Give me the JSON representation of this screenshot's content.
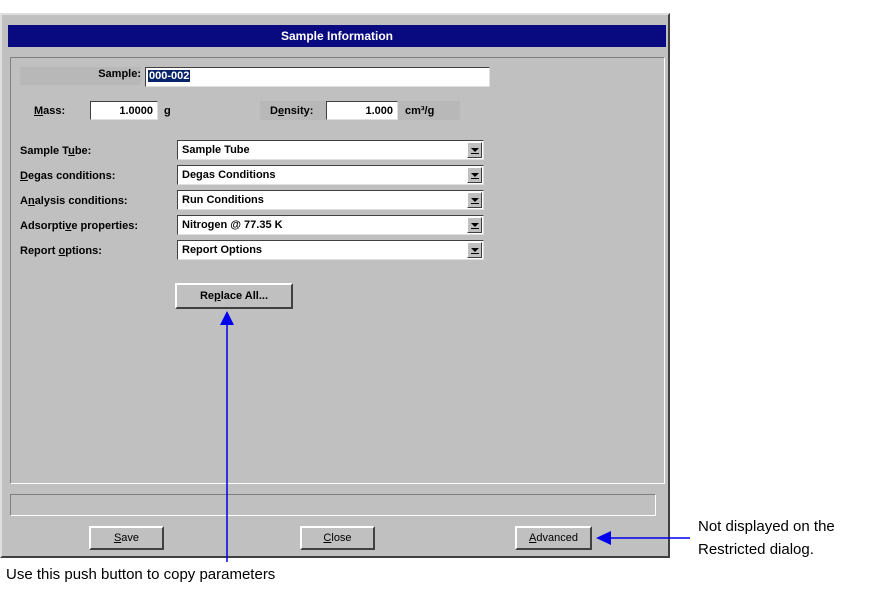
{
  "window": {
    "title": "Sample Information"
  },
  "sample": {
    "label": "Sample:",
    "value": "000-002"
  },
  "mass": {
    "label_pre": "",
    "label_u": "M",
    "label_post": "ass:",
    "value": "1.0000",
    "unit": "g"
  },
  "density": {
    "label_pre": "D",
    "label_u": "e",
    "label_post": "nsity:",
    "value": "1.000",
    "unit": "cm³/g"
  },
  "rows": [
    {
      "label_pre": "Sample T",
      "label_u": "u",
      "label_post": "be:",
      "value": "Sample Tube"
    },
    {
      "label_pre": "",
      "label_u": "D",
      "label_post": "egas conditions:",
      "value": "Degas Conditions"
    },
    {
      "label_pre": "A",
      "label_u": "n",
      "label_post": "alysis conditions:",
      "value": "Run Conditions"
    },
    {
      "label_pre": "Adsorpti",
      "label_u": "v",
      "label_post": "e properties:",
      "value": "Nitrogen @ 77.35 K"
    },
    {
      "label_pre": "Report ",
      "label_u": "o",
      "label_post": "ptions:",
      "value": "Report Options"
    }
  ],
  "buttons": {
    "replace_pre": "Re",
    "replace_u": "p",
    "replace_post": "lace All...",
    "save_u": "S",
    "save_post": "ave",
    "close_u": "C",
    "close_post": "lose",
    "advanced_u": "A",
    "advanced_post": "dvanced"
  },
  "annotations": {
    "advanced_note_line1": "Not displayed on the",
    "advanced_note_line2": "Restricted dialog.",
    "replace_note": "Use this push button to copy parameters"
  },
  "colors": {
    "title_bg": "#0a0a80",
    "arrow": "#0000ee",
    "dialog_bg": "#c0c0c0"
  }
}
